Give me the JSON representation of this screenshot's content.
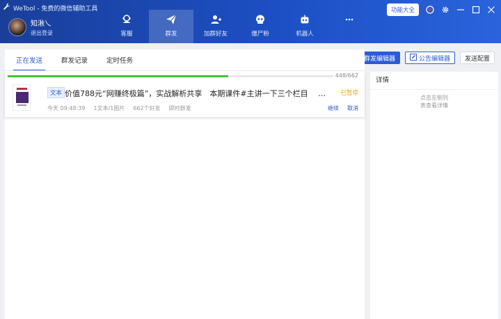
{
  "window": {
    "title": "WeTool - 免费的微信辅助工具"
  },
  "profile": {
    "name": "知湫乀",
    "logout": "退出登录"
  },
  "nav": [
    {
      "label": "客服",
      "icon": "headset-icon"
    },
    {
      "label": "群发",
      "icon": "paper-plane-icon"
    },
    {
      "label": "加群好友",
      "icon": "add-user-icon"
    },
    {
      "label": "僵尸粉",
      "icon": "skull-icon"
    },
    {
      "label": "机器人",
      "icon": "robot-icon"
    },
    {
      "label": "",
      "icon": "more-icon"
    }
  ],
  "controls": {
    "feature_button": "功能大全"
  },
  "tabs": [
    "正在发送",
    "群发记录",
    "定时任务"
  ],
  "toolbar": {
    "editor_button": "群发编辑器",
    "notice_button": "公告编辑器",
    "config_button": "发送配置"
  },
  "task": {
    "progress_text": "448/662",
    "progress_fraction": 0.677,
    "type_tag": "文本",
    "title": "价值788元“网赚终极篇”，实战解析共享　本期课件#主讲一下三个栏目　 …",
    "status": "已暂停",
    "status_color": "#f0a020",
    "time": "今天 09:48:39",
    "content_count": "1文本/1图片",
    "friends": "662个好友",
    "mode": "即时群发",
    "continue_label": "继续",
    "cancel_label": "取消"
  },
  "detail": {
    "title": "详情",
    "empty_line1": "点击左侧列",
    "empty_line2": "表查看详情"
  },
  "colors": {
    "accent": "#2c5bd6",
    "progress": "#47c23a",
    "header": "#1c4fc4"
  }
}
